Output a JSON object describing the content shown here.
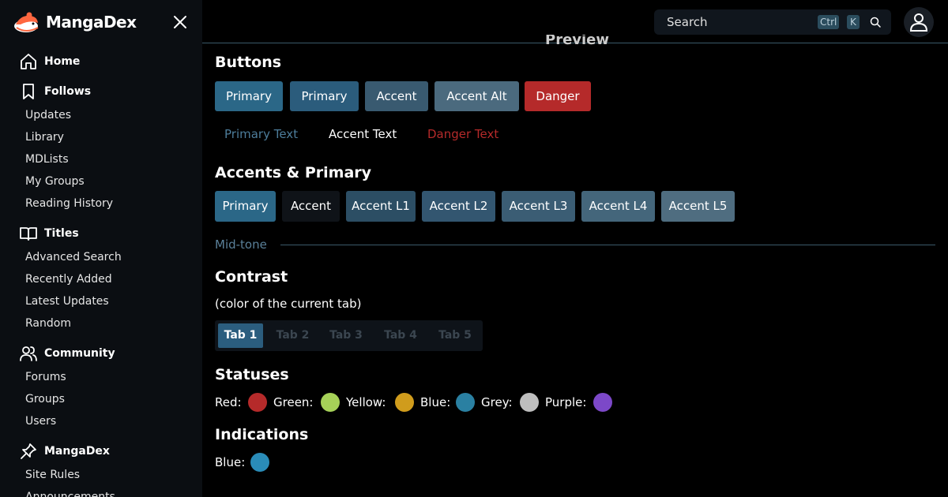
{
  "brand": {
    "name": "MangaDex"
  },
  "sidebar": {
    "sections": [
      {
        "label": "Home",
        "icon": "home-icon"
      },
      {
        "label": "Follows",
        "icon": "bookmark-icon",
        "items": [
          "Updates",
          "Library",
          "MDLists",
          "My Groups",
          "Reading History"
        ]
      },
      {
        "label": "Titles",
        "icon": "book-open-icon",
        "items": [
          "Advanced Search",
          "Recently Added",
          "Latest Updates",
          "Random"
        ]
      },
      {
        "label": "Community",
        "icon": "users-icon",
        "items": [
          "Forums",
          "Groups",
          "Users"
        ]
      },
      {
        "label": "MangaDex",
        "icon": "pin-icon",
        "items": [
          "Site Rules",
          "Announcements"
        ]
      }
    ]
  },
  "topbar": {
    "search_placeholder": "Search",
    "kbd_ctrl": "Ctrl",
    "kbd_k": "K"
  },
  "preview": {
    "title": "Preview",
    "buttons_heading": "Buttons",
    "buttons": [
      {
        "label": "Primary",
        "color": "#2b6787"
      },
      {
        "label": "Primary",
        "color": "#2b5c7c"
      },
      {
        "label": "Accent",
        "color": "#395a70"
      },
      {
        "label": "Accent Alt",
        "color": "#4b6a7e"
      },
      {
        "label": "Danger",
        "color": "#b52a2a"
      }
    ],
    "text_buttons": [
      {
        "label": "Primary Text",
        "color": "#4d7d9b"
      },
      {
        "label": "Accent Text",
        "color": "#ffffff"
      },
      {
        "label": "Danger Text",
        "color": "#b52a2a"
      }
    ],
    "accents_heading": "Accents & Primary",
    "accents": [
      {
        "label": "Primary",
        "color": "#2b6787"
      },
      {
        "label": "Accent",
        "color": "#0f1318"
      },
      {
        "label": "Accent L1",
        "color": "#2c4e64"
      },
      {
        "label": "Accent L2",
        "color": "#335670"
      },
      {
        "label": "Accent L3",
        "color": "#3b5d74"
      },
      {
        "label": "Accent L4",
        "color": "#44667b"
      },
      {
        "label": "Accent L5",
        "color": "#4f6d80"
      }
    ],
    "mid_tone": "Mid-tone",
    "contrast_heading": "Contrast",
    "contrast_sub": "(color of the current tab)",
    "tabs": [
      "Tab 1",
      "Tab 2",
      "Tab 3",
      "Tab 4",
      "Tab 5"
    ],
    "active_tab": "Tab 1",
    "statuses_heading": "Statuses",
    "statuses": [
      {
        "label": "Red:",
        "color": "#b52a2a"
      },
      {
        "label": "Green:",
        "color": "#a6d158"
      },
      {
        "label": "Yellow:",
        "color": "#d09c1c"
      },
      {
        "label": "Blue:",
        "color": "#2a80a2"
      },
      {
        "label": "Grey:",
        "color": "#bebebe"
      },
      {
        "label": "Purple:",
        "color": "#7c48c8"
      }
    ],
    "indications_heading": "Indications",
    "indications": [
      {
        "label": "Blue:",
        "color": "#2a8cb8"
      }
    ]
  }
}
